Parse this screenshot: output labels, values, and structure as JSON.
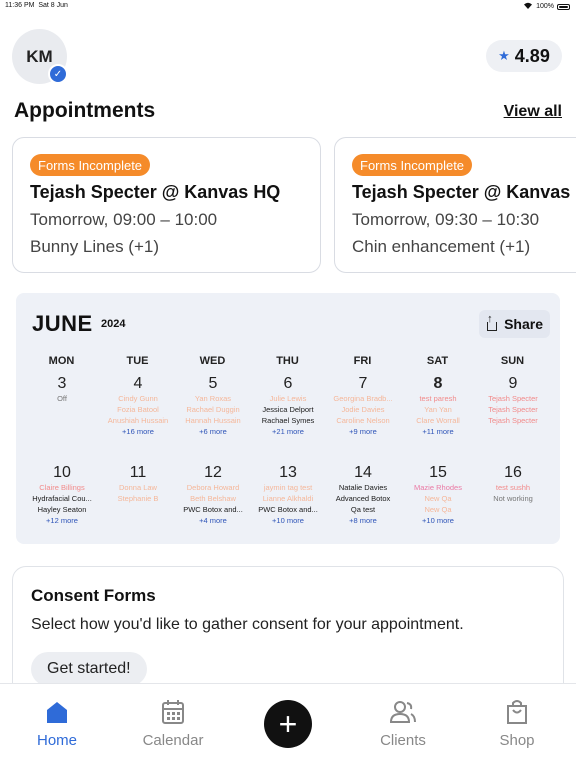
{
  "status_bar": {
    "time": "11:36 PM",
    "date": "Sat 8 Jun",
    "wifi_icon": "wifi-icon",
    "battery": "100%"
  },
  "header": {
    "avatar_initials": "KM",
    "verified_icon": "check-badge-icon",
    "rating_icon": "star-icon",
    "rating": "4.89"
  },
  "appointments": {
    "title": "Appointments",
    "view_all": "View all",
    "cards": [
      {
        "badge": "Forms Incomplete",
        "title": "Tejash Specter @ Kanvas HQ",
        "time": "Tomorrow, 09:00 –  10:00",
        "service": "Bunny Lines (+1)"
      },
      {
        "badge": "Forms Incomplete",
        "title": "Tejash Specter @ Kanvas HQ",
        "time": "Tomorrow, 09:30 –  10:30",
        "service": "Chin enhancement (+1)"
      }
    ]
  },
  "calendar": {
    "month": "JUNE",
    "year": "2024",
    "share_label": "Share",
    "share_icon": "share-icon",
    "weekdays": [
      "MON",
      "TUE",
      "WED",
      "THU",
      "FRI",
      "SAT",
      "SUN"
    ],
    "week1": [
      {
        "num": "3",
        "bold": false,
        "events": [
          {
            "text": "Off",
            "color": "gray"
          }
        ]
      },
      {
        "num": "4",
        "bold": false,
        "events": [
          {
            "text": "Cindy Gunn",
            "color": "peach"
          },
          {
            "text": "Fozia Batool",
            "color": "peach"
          },
          {
            "text": "Anushiah Hussain",
            "color": "peach"
          },
          {
            "text": "+16 more",
            "color": "more"
          }
        ]
      },
      {
        "num": "5",
        "bold": false,
        "events": [
          {
            "text": "Yan Roxas",
            "color": "peach"
          },
          {
            "text": "Rachael Duggin",
            "color": "peach"
          },
          {
            "text": "Hannah Hussain",
            "color": "peach"
          },
          {
            "text": "+6 more",
            "color": "more"
          }
        ]
      },
      {
        "num": "6",
        "bold": false,
        "events": [
          {
            "text": "Julie Lewis",
            "color": "peach"
          },
          {
            "text": "Jessica Delport",
            "color": "dark"
          },
          {
            "text": "Rachael Symes",
            "color": "dark"
          },
          {
            "text": "+21 more",
            "color": "more"
          }
        ]
      },
      {
        "num": "7",
        "bold": false,
        "events": [
          {
            "text": "Georgina Bradb...",
            "color": "peach"
          },
          {
            "text": "Jodie  Davies",
            "color": "peach"
          },
          {
            "text": "Caroline  Nelson",
            "color": "peach"
          },
          {
            "text": "+9 more",
            "color": "more"
          }
        ]
      },
      {
        "num": "8",
        "bold": true,
        "events": [
          {
            "text": "test paresh",
            "color": "pink"
          },
          {
            "text": "Yan Yan",
            "color": "peach"
          },
          {
            "text": "Clare Worrall",
            "color": "peach"
          },
          {
            "text": "+11 more",
            "color": "more"
          }
        ]
      },
      {
        "num": "9",
        "bold": false,
        "events": [
          {
            "text": "Tejash Specter",
            "color": "pink"
          },
          {
            "text": "Tejash Specter",
            "color": "pink"
          },
          {
            "text": "Tejash Specter",
            "color": "pink"
          }
        ]
      }
    ],
    "week2": [
      {
        "num": "10",
        "bold": false,
        "events": [
          {
            "text": "Claire Billings",
            "color": "pink"
          },
          {
            "text": "Hydrafacial Cou...",
            "color": "dark"
          },
          {
            "text": "Hayley Seaton",
            "color": "dark"
          },
          {
            "text": "+12 more",
            "color": "more"
          }
        ]
      },
      {
        "num": "11",
        "bold": false,
        "events": [
          {
            "text": "Donna Law",
            "color": "peach"
          },
          {
            "text": "Stephanie B",
            "color": "peach"
          }
        ]
      },
      {
        "num": "12",
        "bold": false,
        "events": [
          {
            "text": "Debora Howard",
            "color": "peach"
          },
          {
            "text": "Beth Belshaw",
            "color": "peach"
          },
          {
            "text": "PWC Botox and...",
            "color": "dark"
          },
          {
            "text": "+4 more",
            "color": "more"
          }
        ]
      },
      {
        "num": "13",
        "bold": false,
        "events": [
          {
            "text": "jaymin  tag  test",
            "color": "peach"
          },
          {
            "text": "Lianne Alkhaldi",
            "color": "peach"
          },
          {
            "text": "PWC Botox and...",
            "color": "dark"
          },
          {
            "text": "+10 more",
            "color": "more"
          }
        ]
      },
      {
        "num": "14",
        "bold": false,
        "events": [
          {
            "text": "Natalie Davies",
            "color": "dark"
          },
          {
            "text": "Advanced Botox",
            "color": "dark"
          },
          {
            "text": "Qa test",
            "color": "dark"
          },
          {
            "text": "+8 more",
            "color": "more"
          }
        ]
      },
      {
        "num": "15",
        "bold": false,
        "events": [
          {
            "text": "Mazie Rhodes",
            "color": "rose"
          },
          {
            "text": "New Qa",
            "color": "peach"
          },
          {
            "text": "New Qa",
            "color": "peach"
          },
          {
            "text": "+10 more",
            "color": "more"
          }
        ]
      },
      {
        "num": "16",
        "bold": false,
        "events": [
          {
            "text": "test sushh",
            "color": "pink"
          },
          {
            "text": "Not working",
            "color": "gray"
          }
        ]
      }
    ]
  },
  "consent": {
    "title": "Consent Forms",
    "description": "Select how you'd like to gather consent for your appointment.",
    "button": "Get started!"
  },
  "tab_bar": {
    "active_color": "#2f6bd8",
    "tabs": [
      {
        "label": "Home",
        "icon": "home-icon",
        "active": true
      },
      {
        "label": "Calendar",
        "icon": "calendar-icon",
        "active": false
      },
      {
        "label": "Clients",
        "icon": "clients-icon",
        "active": false
      },
      {
        "label": "Shop",
        "icon": "shop-bag-icon",
        "active": false
      }
    ],
    "add_icon": "plus-icon"
  }
}
